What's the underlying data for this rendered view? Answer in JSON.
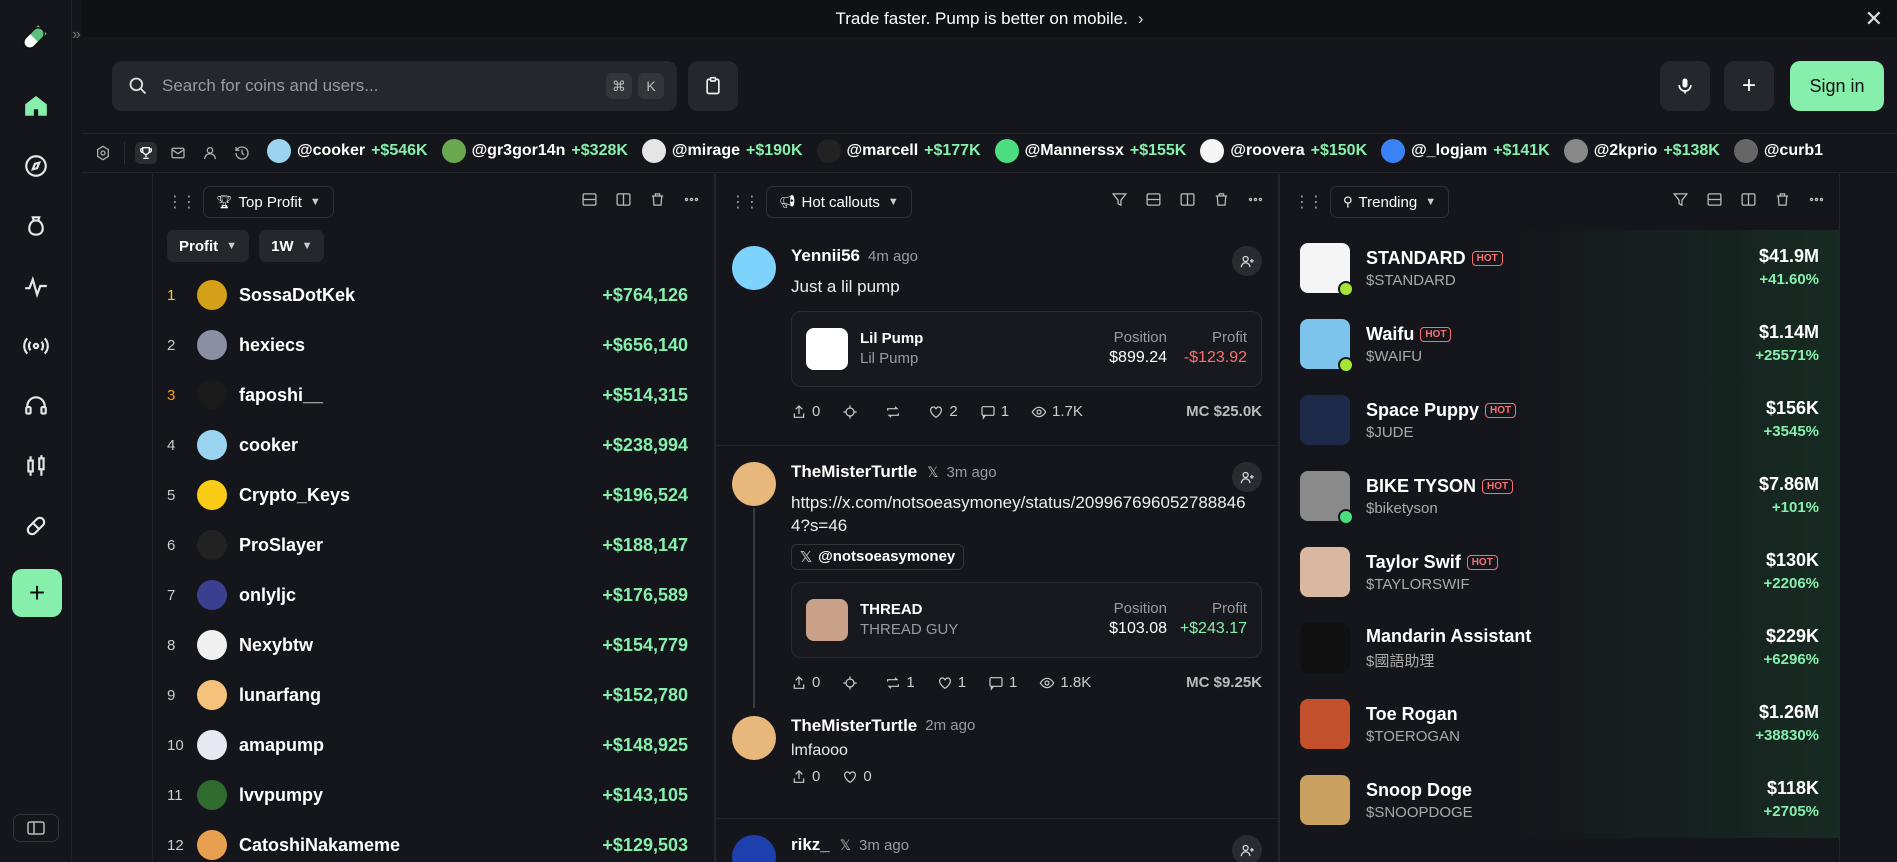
{
  "banner": {
    "text": "Trade faster. Pump is better on mobile.",
    "chevron": "›",
    "close": "✕"
  },
  "rail": {
    "items": [
      {
        "name": "home-icon",
        "active": true
      },
      {
        "name": "compass-icon"
      },
      {
        "name": "bag-icon"
      },
      {
        "name": "activity-icon"
      },
      {
        "name": "broadcast-icon"
      },
      {
        "name": "headset-icon"
      },
      {
        "name": "candlestick-icon"
      },
      {
        "name": "pill-icon"
      }
    ]
  },
  "search": {
    "placeholder": "Search for coins and users...",
    "kbd1": "⌘",
    "kbd2": "K"
  },
  "top": {
    "signin": "Sign in"
  },
  "ticker": [
    {
      "handle": "@cooker",
      "profit": "+$546K",
      "color": "#9ad4f0"
    },
    {
      "handle": "@gr3gor14n",
      "profit": "+$328K",
      "color": "#6aa84f"
    },
    {
      "handle": "@mirage",
      "profit": "+$190K",
      "color": "#e5e5e5"
    },
    {
      "handle": "@marcell",
      "profit": "+$177K",
      "color": "#222"
    },
    {
      "handle": "@Mannerssx",
      "profit": "+$155K",
      "color": "#4ade80"
    },
    {
      "handle": "@roovera",
      "profit": "+$150K",
      "color": "#f5f5f5"
    },
    {
      "handle": "@_logjam",
      "profit": "+$141K",
      "color": "#3b82f6"
    },
    {
      "handle": "@2kprio",
      "profit": "+$138K",
      "color": "#888"
    },
    {
      "handle": "@curb1",
      "profit": "",
      "color": "#666"
    }
  ],
  "leaderboard": {
    "title": "Top Profit",
    "filter1": "Profit",
    "filter2": "1W",
    "rows": [
      {
        "rank": "1",
        "name": "SossaDotKek",
        "profit": "+$764,126",
        "rank_color": "#facc15",
        "av": "#d4a017"
      },
      {
        "rank": "2",
        "name": "hexiecs",
        "profit": "+$656,140",
        "rank_color": "#cccccc",
        "av": "#8a8fa3"
      },
      {
        "rank": "3",
        "name": "faposhi__",
        "profit": "+$514,315",
        "rank_color": "#f59e0b",
        "av": "#1a1a1a"
      },
      {
        "rank": "4",
        "name": "cooker",
        "profit": "+$238,994",
        "rank_color": "#cccccc",
        "av": "#9ad4f0"
      },
      {
        "rank": "5",
        "name": "Crypto_Keys",
        "profit": "+$196,524",
        "rank_color": "#cccccc",
        "av": "#facc15"
      },
      {
        "rank": "6",
        "name": "ProSlayer",
        "profit": "+$188,147",
        "rank_color": "#cccccc",
        "av": "#222"
      },
      {
        "rank": "7",
        "name": "onlyljc",
        "profit": "+$176,589",
        "rank_color": "#cccccc",
        "av": "#3b3f8f"
      },
      {
        "rank": "8",
        "name": "Nexybtw",
        "profit": "+$154,779",
        "rank_color": "#cccccc",
        "av": "#f0f0f0"
      },
      {
        "rank": "9",
        "name": "lunarfang",
        "profit": "+$152,780",
        "rank_color": "#cccccc",
        "av": "#f4c27a"
      },
      {
        "rank": "10",
        "name": "amapump",
        "profit": "+$148,925",
        "rank_color": "#cccccc",
        "av": "#e8e8f0"
      },
      {
        "rank": "11",
        "name": "lvvpumpy",
        "profit": "+$143,105",
        "rank_color": "#cccccc",
        "av": "#2f6b2f"
      },
      {
        "rank": "12",
        "name": "CatoshiNakameme",
        "profit": "+$129,503",
        "rank_color": "#cccccc",
        "av": "#e8a050"
      }
    ]
  },
  "callouts": {
    "title": "Hot callouts",
    "posts": [
      {
        "user": "Yennii56",
        "time": "4m ago",
        "text": "Just a lil pump",
        "coin_name": "Lil Pump",
        "coin_ticker": "Lil Pump",
        "position_label": "Position",
        "position": "$899.24",
        "profit_label": "Profit",
        "profit": "-$123.92",
        "shares": "0",
        "reposts": "",
        "likes": "2",
        "comments": "1",
        "views": "1.7K",
        "mc": "MC $25.0K"
      },
      {
        "user": "TheMisterTurtle",
        "time": "3m ago",
        "text": "https://x.com/notsoeasymoney/status/2099676960527888464?s=46",
        "chip": "@notsoeasymoney",
        "coin_name": "THREAD",
        "coin_ticker": "THREAD GUY",
        "position_label": "Position",
        "position": "$103.08",
        "profit_label": "Profit",
        "profit": "+$243.17",
        "shares": "0",
        "reposts": "1",
        "likes": "1",
        "comments": "1",
        "views": "1.8K",
        "mc": "MC $9.25K"
      },
      {
        "user": "TheMisterTurtle",
        "time": "2m ago",
        "text": "lmfaooo",
        "shares": "0",
        "likes": "0"
      },
      {
        "user": "rikz_",
        "time": "3m ago"
      }
    ]
  },
  "trending": {
    "title": "Trending",
    "hot": "HOT",
    "rows": [
      {
        "name": "STANDARD",
        "ticker": "$STANDARD",
        "mc": "$41.9M",
        "change": "+41.60%",
        "hot": true,
        "img": "#f5f5f5",
        "badge": "#a3e635"
      },
      {
        "name": "Waifu",
        "ticker": "$WAIFU",
        "mc": "$1.14M",
        "change": "+25571%",
        "hot": true,
        "img": "#7cc4ec",
        "badge": "#a3e635"
      },
      {
        "name": "Space Puppy",
        "ticker": "$JUDE",
        "mc": "$156K",
        "change": "+3545%",
        "hot": true,
        "img": "#1e2a4a"
      },
      {
        "name": "BIKE TYSON",
        "ticker": "$biketyson",
        "mc": "$7.86M",
        "change": "+101%",
        "hot": true,
        "img": "#8a8a8a",
        "badge": "#4ade80"
      },
      {
        "name": "Taylor Swif",
        "ticker": "$TAYLORSWIF",
        "mc": "$130K",
        "change": "+2206%",
        "hot": true,
        "img": "#d8b8a0"
      },
      {
        "name": "Mandarin Assistant",
        "ticker": "$國語助理",
        "mc": "$229K",
        "change": "+6296%",
        "hot": false,
        "img": "#111"
      },
      {
        "name": "Toe Rogan",
        "ticker": "$TOEROGAN",
        "mc": "$1.26M",
        "change": "+38830%",
        "hot": false,
        "img": "#c2502a"
      },
      {
        "name": "Snoop Doge",
        "ticker": "$SNOOPDOGE",
        "mc": "$118K",
        "change": "+2705%",
        "hot": false,
        "img": "#c9a060"
      }
    ]
  },
  "colors": {
    "accent": "#86efac",
    "negative": "#f87171",
    "bg": "#15161b"
  }
}
